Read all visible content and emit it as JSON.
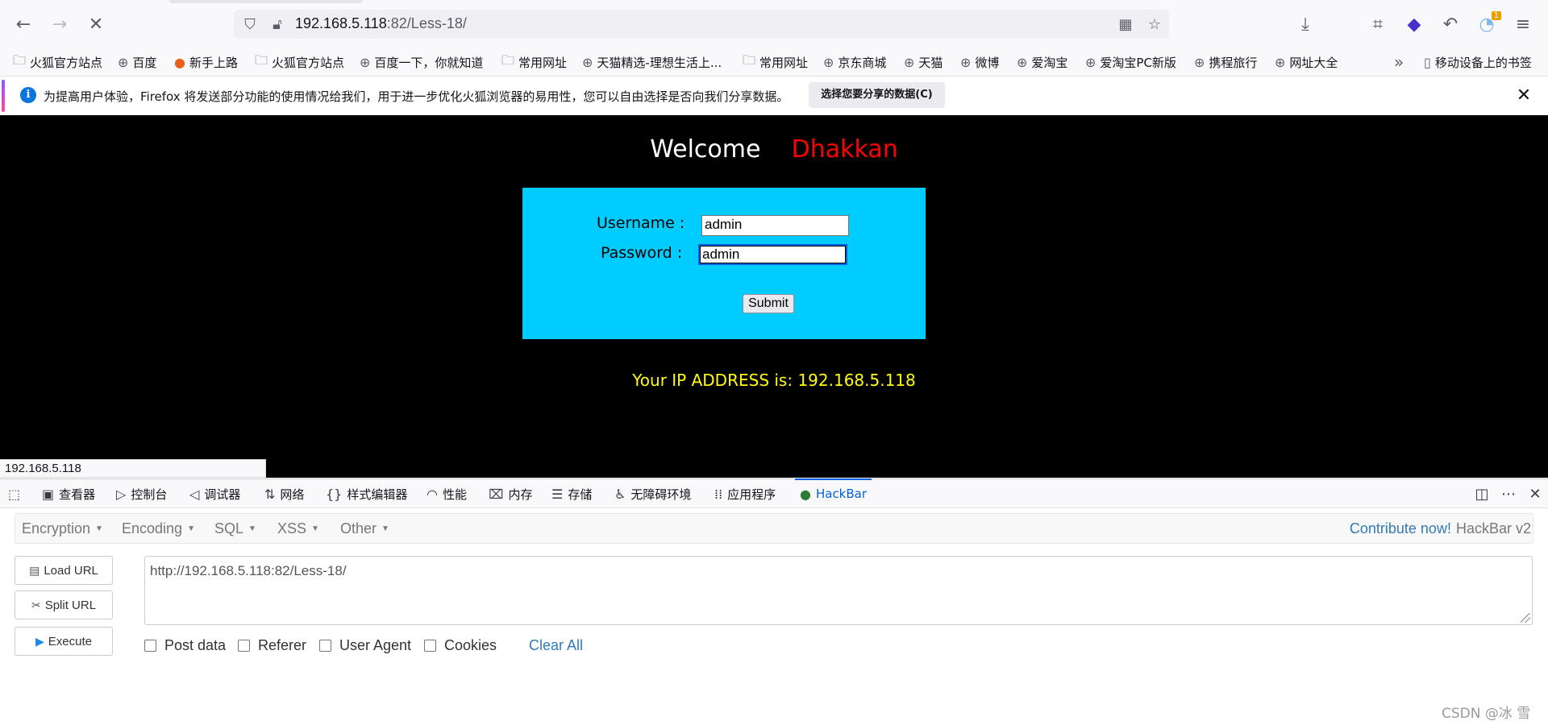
{
  "browser": {
    "url_host": "192.168.5.118",
    "url_path": ":82/Less-18/",
    "bookmarks": [
      "火狐官方站点",
      "百度",
      "新手上路",
      "火狐官方站点",
      "百度一下，你就知道",
      "常用网址",
      "天猫精选-理想生活上...",
      "常用网址",
      "京东商城",
      "天猫",
      "微博",
      "爱淘宝",
      "爱淘宝PC新版",
      "携程旅行",
      "网址大全"
    ],
    "bookmarks_more": "移动设备上的书签",
    "sync_badge": "1"
  },
  "notification": {
    "message": "为提高用户体验，Firefox 将发送部分功能的使用情况给我们，用于进一步优化火狐浏览器的易用性，您可以自由选择是否向我们分享数据。",
    "button": "选择您要分享的数据(C)"
  },
  "page": {
    "welcome": "Welcome",
    "name": "Dhakkan",
    "username_label": "Username :",
    "username_value": "admin",
    "password_label": "Password :",
    "password_value": "admin",
    "submit": "Submit",
    "ip_message": "Your IP ADDRESS is: 192.168.5.118"
  },
  "status_bar": "192.168.5.118",
  "devtools": {
    "tabs": [
      "查看器",
      "控制台",
      "调试器",
      "网络",
      "样式编辑器",
      "性能",
      "内存",
      "存储",
      "无障碍环境",
      "应用程序",
      "HackBar"
    ],
    "selected": "HackBar"
  },
  "hackbar": {
    "menus": [
      "Encryption",
      "Encoding",
      "SQL",
      "XSS",
      "Other"
    ],
    "contribute": "Contribute now!",
    "version": "HackBar v2",
    "buttons": [
      "Load URL",
      "Split URL",
      "Execute"
    ],
    "url": "http://192.168.5.118:82/Less-18/",
    "options": [
      "Post data",
      "Referer",
      "User Agent",
      "Cookies"
    ],
    "clear_all": "Clear All"
  },
  "watermark": "CSDN @冰 雪",
  "colors": {
    "page_bg": "#000000",
    "login_bg": "#00ccff",
    "name_red": "#ff0000",
    "ip_yellow": "#ffff00",
    "accent": "#0060df"
  }
}
